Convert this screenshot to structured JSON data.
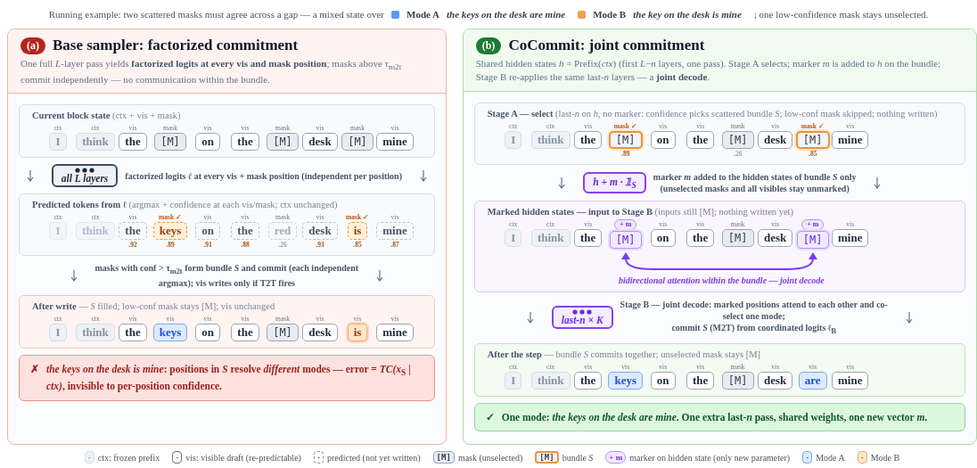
{
  "intro": {
    "lead": "Running example: two scattered masks must agree across a gap — a mixed state over",
    "modes": [
      {
        "label": "Mode A",
        "example": "the keys on the desk are mine",
        "color": "#5b9cf0"
      },
      {
        "label": "Mode B",
        "example": "the key on the desk is mine",
        "color": "#f0a050"
      }
    ],
    "tail": "; one low-confidence mask stays unselected."
  },
  "panels": [
    {
      "kind": "base",
      "badge": "(a)",
      "title": "Base sampler: factorized commitment",
      "description": "One full *L*-layer pass yields **factorized logits at every vis and mask position**; masks above τ$_{m2t}$ commit independently — no communication within the bundle.",
      "sections": [
        {
          "kind": "block-plain",
          "heading": "**Current block state** (ctx + vis + mask)",
          "tokens": [
            {
              "tag": "ctx",
              "text": "I",
              "kind": "ctx"
            },
            {
              "tag": "ctx",
              "text": "think",
              "kind": "ctx"
            },
            {
              "tag": "vis",
              "text": "the",
              "kind": "vis"
            },
            {
              "tag": "mask",
              "text": "[M]",
              "kind": "mask"
            },
            {
              "tag": "vis",
              "text": "on",
              "kind": "vis"
            },
            {
              "tag": "vis",
              "text": "the",
              "kind": "vis"
            },
            {
              "tag": "mask",
              "text": "[M]",
              "kind": "mask"
            },
            {
              "tag": "vis",
              "text": "desk",
              "kind": "vis"
            },
            {
              "tag": "mask",
              "text": "[M]",
              "kind": "mask"
            },
            {
              "tag": "vis",
              "text": "mine",
              "kind": "vis"
            }
          ]
        },
        {
          "kind": "step",
          "chip": {
            "dots": true,
            "text": "all L layers"
          },
          "lines": [
            "factorized logits *ℓ* at every vis + mask position (independent per position)"
          ]
        },
        {
          "kind": "block-plain",
          "heading": "**Predicted tokens from ℓ** (argmax + confidence at each vis/mask; ctx unchanged)",
          "tokens": [
            {
              "tag": "ctx",
              "text": "I",
              "kind": "ctx-faded"
            },
            {
              "tag": "ctx",
              "text": "think",
              "kind": "ctx-faded"
            },
            {
              "tag": "vis",
              "text": "the",
              "kind": "pred",
              "score": ".92"
            },
            {
              "tag": "mask ✓",
              "text": "keys",
              "kind": "pred-pick",
              "score": ".89"
            },
            {
              "tag": "vis",
              "text": "on",
              "kind": "pred",
              "score": ".91"
            },
            {
              "tag": "vis",
              "text": "the",
              "kind": "pred",
              "score": ".88"
            },
            {
              "tag": "mask",
              "text": "red",
              "kind": "pred-low",
              "score": ".26"
            },
            {
              "tag": "vis",
              "text": "desk",
              "kind": "pred",
              "score": ".93"
            },
            {
              "tag": "mask ✓",
              "text": "is",
              "kind": "pred-pick",
              "score": ".85"
            },
            {
              "tag": "vis",
              "text": "mine",
              "kind": "pred",
              "score": ".87"
            }
          ]
        },
        {
          "kind": "step",
          "lines": [
            "masks with conf > τ$_{m2t}$ form bundle *S* and commit (each independent",
            "argmax); vis writes only if T2T fires"
          ]
        },
        {
          "kind": "block-error",
          "heading": "**After write** — *S* filled; low-conf mask stays [M]; vis unchanged",
          "tokens": [
            {
              "tag": "ctx",
              "text": "I",
              "kind": "ctx"
            },
            {
              "tag": "ctx",
              "text": "think",
              "kind": "ctx"
            },
            {
              "tag": "vis",
              "text": "the",
              "kind": "vis"
            },
            {
              "tag": "vis",
              "text": "keys",
              "kind": "modeA"
            },
            {
              "tag": "vis",
              "text": "on",
              "kind": "vis"
            },
            {
              "tag": "vis",
              "text": "the",
              "kind": "vis"
            },
            {
              "tag": "mask",
              "text": "[M]",
              "kind": "mask"
            },
            {
              "tag": "vis",
              "text": "desk",
              "kind": "vis"
            },
            {
              "tag": "vis",
              "text": "is",
              "kind": "modeB"
            },
            {
              "tag": "vis",
              "text": "mine",
              "kind": "vis"
            }
          ]
        },
        {
          "kind": "verdict-error",
          "icon": "✗",
          "text": "*the keys on the desk is mine*: positions in *S* resolve *different* modes — error = *TC(x*$_{S}$ | *ctx)*, invisible to per-position confidence."
        }
      ]
    },
    {
      "kind": "joint",
      "badge": "(b)",
      "title": "CoCommit: joint commitment",
      "description": "Shared hidden states *h* = Prefix(*ctx*) (first *L*−*n* layers, one pass). Stage A selects; marker *m* is added to *h* on the bundle; Stage B re-applies the same last-*n* layers — a **joint decode**.",
      "sections": [
        {
          "kind": "block-plain",
          "heading": "**Stage A — select** (last-*n* on *h*, no marker: confidence picks scattered bundle *S*; low-conf mask skipped; nothing written)",
          "tokens": [
            {
              "tag": "ctx",
              "text": "I",
              "kind": "ctx"
            },
            {
              "tag": "ctx",
              "text": "think",
              "kind": "ctx"
            },
            {
              "tag": "vis",
              "text": "the",
              "kind": "vis"
            },
            {
              "tag": "mask ✓",
              "text": "[M]",
              "kind": "bundle",
              "score": ".89"
            },
            {
              "tag": "vis",
              "text": "on",
              "kind": "vis"
            },
            {
              "tag": "vis",
              "text": "the",
              "kind": "vis"
            },
            {
              "tag": "mask",
              "text": "[M]",
              "kind": "mask",
              "score": ".26"
            },
            {
              "tag": "vis",
              "text": "desk",
              "kind": "vis"
            },
            {
              "tag": "mask ✓",
              "text": "[M]",
              "kind": "bundle",
              "score": ".85"
            },
            {
              "tag": "vis",
              "text": "mine",
              "kind": "vis"
            }
          ]
        },
        {
          "kind": "step",
          "chip": {
            "dots": false,
            "text": "h + m · 𝟙$_{S}$"
          },
          "lines": [
            "marker *m* added to the hidden states of bundle *S* only",
            "(unselected masks and all visibles stay unmarked)"
          ]
        },
        {
          "kind": "block-marked",
          "heading": "**Marked hidden states — input to Stage B** (inputs still [M]; nothing written yet)",
          "tokens": [
            {
              "tag": "ctx",
              "text": "I",
              "kind": "ctx"
            },
            {
              "tag": "ctx",
              "text": "think",
              "kind": "ctx"
            },
            {
              "tag": "vis",
              "text": "the",
              "kind": "vis"
            },
            {
              "marker": "+ m",
              "text": "[M]",
              "kind": "marked"
            },
            {
              "tag": "vis",
              "text": "on",
              "kind": "vis"
            },
            {
              "tag": "vis",
              "text": "the",
              "kind": "vis"
            },
            {
              "tag": "mask",
              "text": "[M]",
              "kind": "mask"
            },
            {
              "tag": "vis",
              "text": "desk",
              "kind": "vis"
            },
            {
              "marker": "+ m",
              "text": "[M]",
              "kind": "marked"
            },
            {
              "tag": "vis",
              "text": "mine",
              "kind": "vis"
            }
          ],
          "arc": {
            "caption": "bidirectional attention within the bundle — joint decode"
          }
        },
        {
          "kind": "step",
          "chip": {
            "dots": true,
            "text": "last-n × K"
          },
          "lines": [
            "Stage B — joint decode: marked positions attend to each other and co-",
            "select one mode;",
            "commit *S* (M2T) from coordinated logits ℓ$_{B}$"
          ]
        },
        {
          "kind": "block-success",
          "heading": "**After the step** — bundle *S* commits together; unselected mask stays [M]",
          "tokens": [
            {
              "tag": "ctx",
              "text": "I",
              "kind": "ctx"
            },
            {
              "tag": "ctx",
              "text": "think",
              "kind": "ctx"
            },
            {
              "tag": "vis",
              "text": "the",
              "kind": "vis"
            },
            {
              "tag": "vis",
              "text": "keys",
              "kind": "modeA"
            },
            {
              "tag": "vis",
              "text": "on",
              "kind": "vis"
            },
            {
              "tag": "vis",
              "text": "the",
              "kind": "vis"
            },
            {
              "tag": "mask",
              "text": "[M]",
              "kind": "mask"
            },
            {
              "tag": "vis",
              "text": "desk",
              "kind": "vis"
            },
            {
              "tag": "vis",
              "text": "are",
              "kind": "modeA"
            },
            {
              "tag": "vis",
              "text": "mine",
              "kind": "vis"
            }
          ]
        },
        {
          "kind": "verdict-success",
          "icon": "✓",
          "text": "One mode: *the keys on the desk are mine*. One extra last-*n* pass, shared weights, one new vector *m*."
        }
      ]
    }
  ],
  "legend": [
    {
      "kind": "ctx",
      "swatch": "·",
      "label": "ctx: frozen prefix"
    },
    {
      "kind": "vis",
      "swatch": "·",
      "label": "vis: visible draft (re-predictable)"
    },
    {
      "kind": "pred",
      "swatch": "·",
      "label": "predicted (not yet written)"
    },
    {
      "kind": "mask",
      "swatch": "[M]",
      "label": "mask (unselected)"
    },
    {
      "kind": "bundle",
      "swatch": "[M]",
      "label": "bundle *S*"
    },
    {
      "kind": "marker",
      "swatch": "+ m",
      "label": "marker on hidden state (only new parameter)"
    },
    {
      "kind": "modeA",
      "swatch": "·",
      "label": "Mode A"
    },
    {
      "kind": "modeB",
      "swatch": "·",
      "label": "Mode B"
    }
  ]
}
